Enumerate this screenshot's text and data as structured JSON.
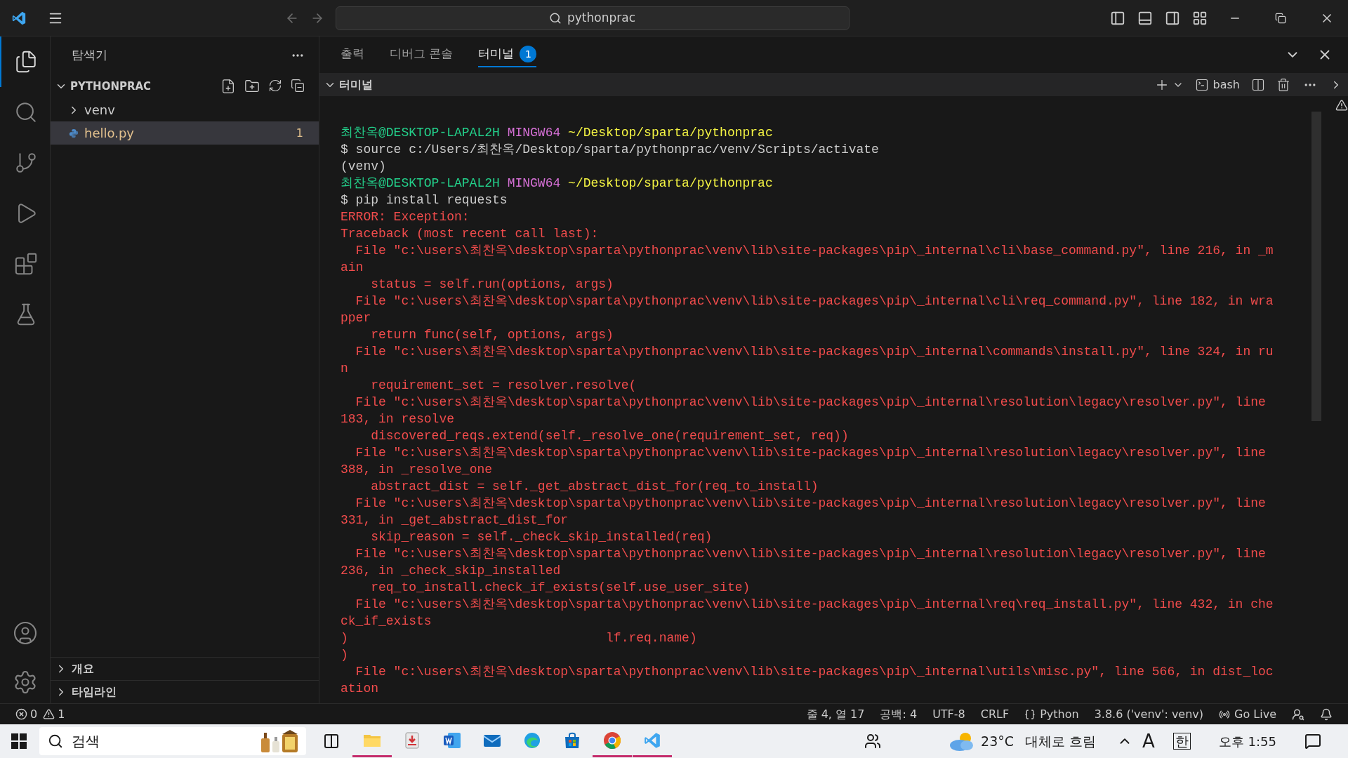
{
  "title_bar": {
    "search": "pythonprac"
  },
  "sidebar": {
    "title": "탐색기",
    "folder": {
      "name": "PYTHONPRAC",
      "expanded": true,
      "children": [
        {
          "name": "venv",
          "kind": "folder",
          "expanded": false,
          "selected": false
        },
        {
          "name": "hello.py",
          "kind": "file",
          "selected": true,
          "badge": "1"
        }
      ]
    },
    "sections": [
      {
        "label": "개요",
        "expanded": false
      },
      {
        "label": "타임라인",
        "expanded": false
      }
    ]
  },
  "panel": {
    "tabs": [
      {
        "label": "출력",
        "selected": false
      },
      {
        "label": "디버그 콘솔",
        "selected": false
      },
      {
        "label": "터미널",
        "selected": true,
        "badge": "1"
      }
    ],
    "terminal": {
      "title": "터미널",
      "shell": "bash",
      "lines": [
        {
          "kind": "prompt",
          "user": "최찬옥@DESKTOP-LAPAL2H",
          "env": "MINGW64",
          "path": "~/Desktop/sparta/pythonprac"
        },
        {
          "kind": "command",
          "text": "$ source c:/Users/최찬옥/Desktop/sparta/pythonprac/venv/Scripts/activate"
        },
        {
          "kind": "output",
          "text": "(venv)"
        },
        {
          "kind": "prompt",
          "user": "최찬옥@DESKTOP-LAPAL2H",
          "env": "MINGW64",
          "path": "~/Desktop/sparta/pythonprac"
        },
        {
          "kind": "command",
          "text": "$ pip install requests"
        },
        {
          "kind": "error",
          "text": "ERROR: Exception:"
        },
        {
          "kind": "error",
          "text": "Traceback (most recent call last):"
        },
        {
          "kind": "error",
          "text": "  File \"c:\\users\\최찬옥\\desktop\\sparta\\pythonprac\\venv\\lib\\site-packages\\pip\\_internal\\cli\\base_command.py\", line 216, in _m"
        },
        {
          "kind": "error",
          "text": "ain"
        },
        {
          "kind": "error",
          "text": "    status = self.run(options, args)"
        },
        {
          "kind": "error",
          "text": "  File \"c:\\users\\최찬옥\\desktop\\sparta\\pythonprac\\venv\\lib\\site-packages\\pip\\_internal\\cli\\req_command.py\", line 182, in wra"
        },
        {
          "kind": "error",
          "text": "pper"
        },
        {
          "kind": "error",
          "text": "    return func(self, options, args)"
        },
        {
          "kind": "error",
          "text": "  File \"c:\\users\\최찬옥\\desktop\\sparta\\pythonprac\\venv\\lib\\site-packages\\pip\\_internal\\commands\\install.py\", line 324, in ru"
        },
        {
          "kind": "error",
          "text": "n"
        },
        {
          "kind": "error",
          "text": "    requirement_set = resolver.resolve("
        },
        {
          "kind": "error",
          "text": "  File \"c:\\users\\최찬옥\\desktop\\sparta\\pythonprac\\venv\\lib\\site-packages\\pip\\_internal\\resolution\\legacy\\resolver.py\", line"
        },
        {
          "kind": "error",
          "text": "183, in resolve"
        },
        {
          "kind": "error",
          "text": "    discovered_reqs.extend(self._resolve_one(requirement_set, req))"
        },
        {
          "kind": "error",
          "text": "  File \"c:\\users\\최찬옥\\desktop\\sparta\\pythonprac\\venv\\lib\\site-packages\\pip\\_internal\\resolution\\legacy\\resolver.py\", line"
        },
        {
          "kind": "error",
          "text": "388, in _resolve_one"
        },
        {
          "kind": "error",
          "text": "    abstract_dist = self._get_abstract_dist_for(req_to_install)"
        },
        {
          "kind": "error",
          "text": "  File \"c:\\users\\최찬옥\\desktop\\sparta\\pythonprac\\venv\\lib\\site-packages\\pip\\_internal\\resolution\\legacy\\resolver.py\", line"
        },
        {
          "kind": "error",
          "text": "331, in _get_abstract_dist_for"
        },
        {
          "kind": "error",
          "text": "    skip_reason = self._check_skip_installed(req)"
        },
        {
          "kind": "error",
          "text": "  File \"c:\\users\\최찬옥\\desktop\\sparta\\pythonprac\\venv\\lib\\site-packages\\pip\\_internal\\resolution\\legacy\\resolver.py\", line"
        },
        {
          "kind": "error",
          "text": "236, in _check_skip_installed"
        },
        {
          "kind": "error",
          "text": "    req_to_install.check_if_exists(self.use_user_site)"
        },
        {
          "kind": "error",
          "text": "  File \"c:\\users\\최찬옥\\desktop\\sparta\\pythonprac\\venv\\lib\\site-packages\\pip\\_internal\\req\\req_install.py\", line 432, in che"
        },
        {
          "kind": "error",
          "text": "ck_if_exists"
        },
        {
          "kind": "error",
          "text": ")                                  lf.req.name)"
        },
        {
          "kind": "error",
          "text": ")"
        },
        {
          "kind": "error",
          "text": "  File \"c:\\users\\최찬옥\\desktop\\sparta\\pythonprac\\venv\\lib\\site-packages\\pip\\_internal\\utils\\misc.py\", line 566, in dist_loc"
        },
        {
          "kind": "error",
          "text": "ation"
        }
      ]
    }
  },
  "status_bar": {
    "errors": "0",
    "warnings": "1",
    "items": [
      {
        "kind": "text",
        "text": "줄 4, 열 17"
      },
      {
        "kind": "text",
        "text": "공백: 4"
      },
      {
        "kind": "text",
        "text": "UTF-8"
      },
      {
        "kind": "text",
        "text": "CRLF"
      },
      {
        "kind": "language",
        "text": "Python"
      },
      {
        "kind": "text",
        "text": "3.8.6 ('venv': venv)"
      },
      {
        "kind": "live",
        "text": "Go Live"
      }
    ]
  },
  "taskbar": {
    "search": "검색",
    "apps": [
      {
        "kind": "files",
        "running": true
      },
      {
        "kind": "downloads",
        "running": false
      },
      {
        "kind": "word",
        "running": false
      },
      {
        "kind": "mail",
        "running": false
      },
      {
        "kind": "edge",
        "running": false
      },
      {
        "kind": "store",
        "running": false
      },
      {
        "kind": "chrome",
        "running": true
      },
      {
        "kind": "vscode",
        "running": true
      }
    ],
    "temperature": "23°C",
    "weather": "대체로 흐림",
    "ime": "A",
    "lang": "한",
    "time": "오후 1:55"
  }
}
